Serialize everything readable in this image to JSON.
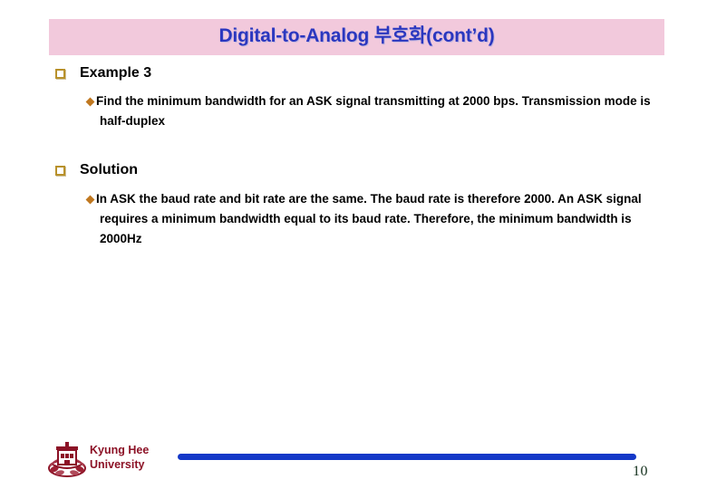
{
  "slide": {
    "title": "Digital-to-Analog 부호화(cont’d)",
    "title_color": "#2b37bf",
    "banner_color": "#f2c9dc"
  },
  "blocks": [
    {
      "heading": "Example 3",
      "bullet_icon": "square-outline-bullet-icon",
      "body": "Find the minimum bandwidth for an ASK signal transmitting at 2000 bps. Transmission mode is half-duplex",
      "sub_bullet_icon": "diamond-bullet-icon"
    },
    {
      "heading": "Solution",
      "bullet_icon": "square-outline-bullet-icon",
      "body": "In ASK the baud rate and bit rate are the same. The baud rate is therefore 2000. An ASK signal requires a minimum bandwidth equal to its baud rate. Therefore, the minimum bandwidth is 2000Hz",
      "sub_bullet_icon": "diamond-bullet-icon"
    }
  ],
  "footer": {
    "logo_line1": "Kyung Hee",
    "logo_line2": "University",
    "logo_color": "#8c1226",
    "rule_color": "#1438c8",
    "page_number": "10"
  }
}
